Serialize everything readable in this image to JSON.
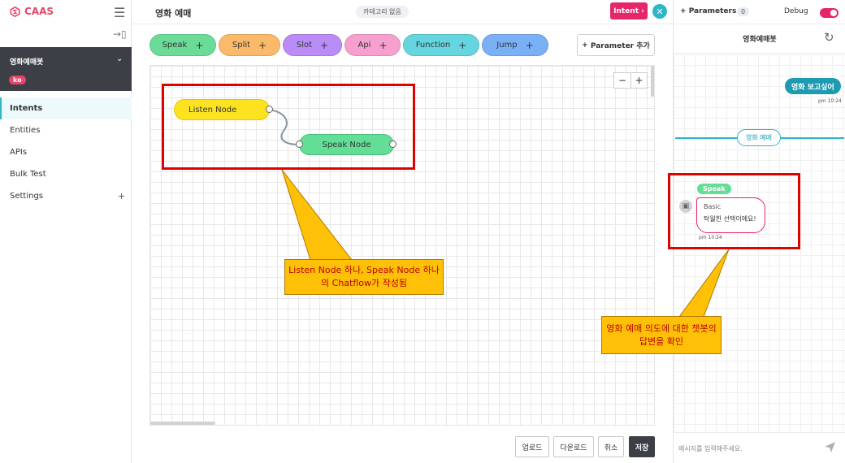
{
  "brand": {
    "name": "CAAS"
  },
  "sidebar": {
    "bot_name": "영화예매봇",
    "language": "ko",
    "items": [
      {
        "label": "Intents"
      },
      {
        "label": "Entities"
      },
      {
        "label": "APIs"
      },
      {
        "label": "Bulk Test"
      },
      {
        "label": "Settings"
      }
    ]
  },
  "header": {
    "title": "영화 예매",
    "category": "카테고리 없음",
    "intent_button": "Intent"
  },
  "toolbar": {
    "nodes": [
      {
        "label": "Speak",
        "color": "#6bdc98"
      },
      {
        "label": "Split",
        "color": "#fbb96a"
      },
      {
        "label": "Slot",
        "color": "#b98cf7"
      },
      {
        "label": "Api",
        "color": "#f7a0cf"
      },
      {
        "label": "Function",
        "color": "#65d6e0"
      },
      {
        "label": "Jump",
        "color": "#7ab0f5"
      }
    ],
    "parameter_add": "Parameter 추가"
  },
  "canvas": {
    "zoom_out": "−",
    "zoom_in": "+",
    "listen_node": "Listen Node",
    "speak_node": "Speak Node"
  },
  "actions": {
    "upload": "업로드",
    "download": "다운로드",
    "cancel": "취소",
    "save": "저장"
  },
  "panel": {
    "parameters_label": "Parameters",
    "parameters_count": "0",
    "debug_label": "Debug",
    "debug_on": true,
    "bot_name": "영화예매봇",
    "user_message": "영화 보고싶어",
    "user_time": "pm 10:24",
    "intent_tag": "영화 예매",
    "node_tag": "Speak",
    "bot_type": "Basic",
    "bot_message": "탁월한 선택이에요!",
    "bot_time": "pm 10:24",
    "input_placeholder": "메시지를 입력해주세요."
  },
  "annotations": {
    "left_callout": "Listen Node 하나, Speak Node 하나의 Chatflow가 작성됨",
    "right_callout": "영화 예매 의도에 대한 챗봇의 답변을 확인"
  },
  "colors": {
    "brand": "#e8456b",
    "accent": "#2cb6c8",
    "intent_button": "#e5266a",
    "highlight": "#e00000",
    "callout": "#fec107"
  }
}
